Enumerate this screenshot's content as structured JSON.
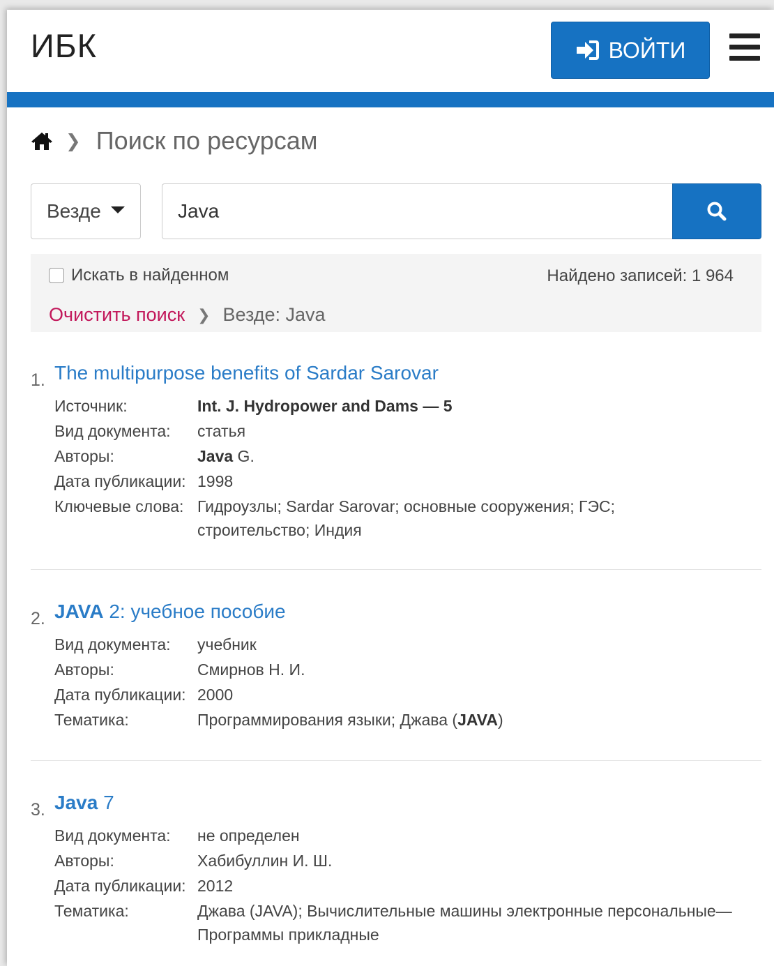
{
  "header": {
    "logo": "ИБК",
    "login_label": "ВОЙТИ"
  },
  "breadcrumb": {
    "title": "Поиск по ресурсам"
  },
  "search": {
    "scope": "Везде",
    "query": "Java"
  },
  "filters": {
    "search_in_found": "Искать в найденном",
    "found_count": "Найдено записей: 1 964",
    "clear_label": "Очистить поиск",
    "current_query": "Везде: Java"
  },
  "labels": {
    "source": "Источник:",
    "doc_type": "Вид документа:",
    "authors": "Авторы:",
    "pub_date": "Дата публикации:",
    "keywords": "Ключевые слова:",
    "subject": "Тематика:"
  },
  "results": [
    {
      "num": "1.",
      "title": "The multipurpose benefits of Sardar Sarovar",
      "source": "Int. J. Hydropower and Dams — 5",
      "doc_type": "статья",
      "authors_bold": "Java",
      "authors_rest": " G.",
      "pub_date": "1998",
      "keywords_line1": "Гидроузлы; Sardar Sarovar; основные сооружения; ГЭС;",
      "keywords_line2": "строительство; Индия"
    },
    {
      "num": "2.",
      "title_bold": "JAVA",
      "title_rest": " 2: учебное пособие",
      "doc_type": "учебник",
      "authors": "Смирнов Н. И.",
      "pub_date": "2000",
      "subject_pre": "Программирования языки; Джава (",
      "subject_bold": "JAVA",
      "subject_post": ")"
    },
    {
      "num": "3.",
      "title_bold": "Java",
      "title_rest": " 7",
      "doc_type": "не определен",
      "authors": "Хабибуллин И. Ш.",
      "pub_date": "2012",
      "subject_line1": "Джава (JAVA); Вычислительные машины электронные персональные—",
      "subject_line2": "Программы прикладные"
    }
  ]
}
